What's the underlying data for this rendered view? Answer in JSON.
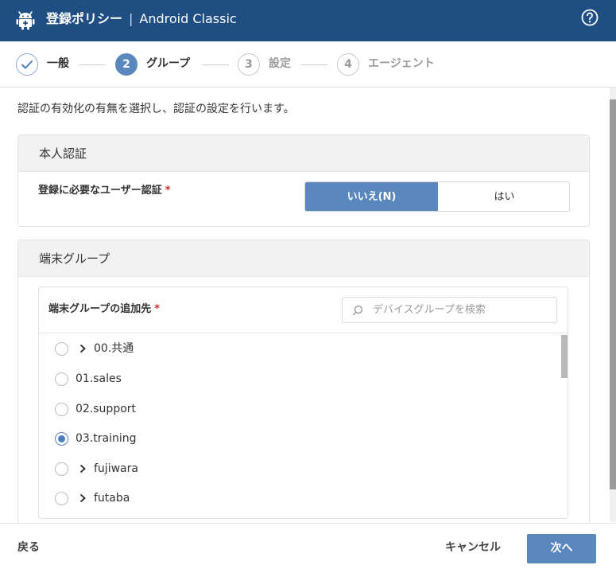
{
  "header": {
    "policy_label": "登録ポリシー",
    "separator": "|",
    "title": "Android Classic",
    "help_icon": "question-circle-icon",
    "app_icon": "android-plus-icon"
  },
  "steps": [
    {
      "number": "",
      "label": "一般",
      "state": "done"
    },
    {
      "number": "2",
      "label": "グループ",
      "state": "active"
    },
    {
      "number": "3",
      "label": "設定",
      "state": "pending"
    },
    {
      "number": "4",
      "label": "エージェント",
      "state": "pending"
    }
  ],
  "description": "認証の有効化の有無を選択し、認証の設定を行います。",
  "auth_section": {
    "title": "本人認証",
    "field_label": "登録に必要なユーザー認証",
    "required_mark": "*",
    "options": {
      "no": "いいえ(N)",
      "yes": "はい"
    },
    "selected": "no"
  },
  "group_section": {
    "title": "端末グループ",
    "field_label": "端末グループの追加先",
    "required_mark": "*",
    "search_placeholder": "デバイスグループを検索",
    "groups": [
      {
        "label": "00.共通",
        "expandable": true,
        "selected": false
      },
      {
        "label": "01.sales",
        "expandable": false,
        "selected": false
      },
      {
        "label": "02.support",
        "expandable": false,
        "selected": false
      },
      {
        "label": "03.training",
        "expandable": false,
        "selected": true
      },
      {
        "label": "fujiwara",
        "expandable": true,
        "selected": false
      },
      {
        "label": "futaba",
        "expandable": true,
        "selected": false
      }
    ]
  },
  "footer": {
    "back": "戻る",
    "cancel": "キャンセル",
    "next": "次へ"
  },
  "colors": {
    "header_bg": "#1f4f82",
    "accent": "#5a87bd",
    "required": "#d0302d"
  }
}
